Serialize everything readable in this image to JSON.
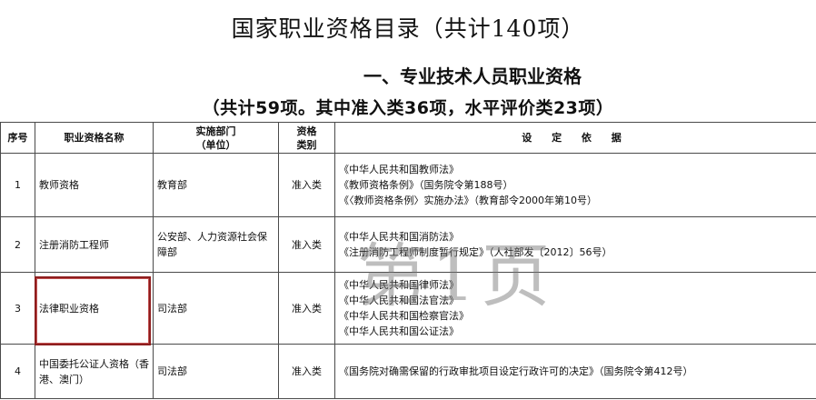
{
  "doc": {
    "title": "国家职业资格目录（共计140项）",
    "section_heading": "一、专业技术人员职业资格",
    "count_summary": "（共计59项。其中准入类36项，水平评价类23项）"
  },
  "table": {
    "headers": {
      "no": "序号",
      "name": "职业资格名称",
      "dept_line1": "实施部门",
      "dept_line2": "（单位）",
      "type_line1": "资格",
      "type_line2": "类别",
      "basis": "设 定 依 据"
    },
    "rows": [
      {
        "no": "1",
        "name": "教师资格",
        "dept": "教育部",
        "type": "准入类",
        "basis": [
          "《中华人民共和国教师法》",
          "《教师资格条例》（国务院令第188号）",
          "《〈教师资格条例〉实施办法》（教育部令2000年第10号）"
        ]
      },
      {
        "no": "2",
        "name": "注册消防工程师",
        "dept": "公安部、人力资源社会保障部",
        "type": "准入类",
        "basis": [
          "《中华人民共和国消防法》",
          "《注册消防工程师制度暂行规定》（人社部发〔2012〕56号）"
        ]
      },
      {
        "no": "3",
        "name": "法律职业资格",
        "dept": "司法部",
        "type": "准入类",
        "basis": [
          "《中华人民共和国律师法》",
          "《中华人民共和国法官法》",
          "《中华人民共和国检察官法》",
          "《中华人民共和国公证法》"
        ]
      },
      {
        "no": "4",
        "name": "中国委托公证人资格（香港、澳门）",
        "dept": "司法部",
        "type": "准入类",
        "basis": [
          "《国务院对确需保留的行政审批项目设定行政许可的决定》（国务院令第412号）"
        ]
      }
    ]
  },
  "watermark": {
    "text": "第1页"
  }
}
